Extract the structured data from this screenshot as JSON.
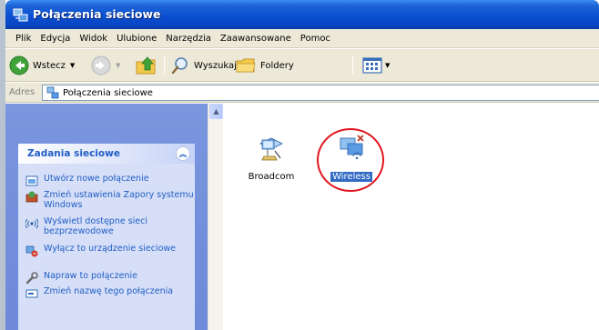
{
  "window": {
    "title": "Połączenia sieciowe"
  },
  "menu": [
    "Plik",
    "Edycja",
    "Widok",
    "Ulubione",
    "Narzędzia",
    "Zaawansowane",
    "Pomoc"
  ],
  "toolbar": {
    "back_label": "Wstecz",
    "search_label": "Wyszukaj",
    "folders_label": "Foldery"
  },
  "address": {
    "label": "Adres",
    "value": "Połączenia sieciowe"
  },
  "tasks": {
    "title": "Zadania sieciowe",
    "items": [
      "Utwórz nowe połączenie",
      "Zmień ustawienia Zapory systemu Windows",
      "Wyświetl dostępne sieci bezprzewodowe",
      "Wyłącz to urządzenie sieciowe",
      "Napraw to połączenie",
      "Zmień nazwę tego połączenia"
    ]
  },
  "connections": [
    {
      "label": "Broadcom",
      "selected": false
    },
    {
      "label": "Wireless",
      "selected": true
    }
  ],
  "colors": {
    "titlebar": "#0a4fd1",
    "task_link": "#215dc6",
    "selection": "#316ac5",
    "annotation_circle": "#e0151d"
  }
}
